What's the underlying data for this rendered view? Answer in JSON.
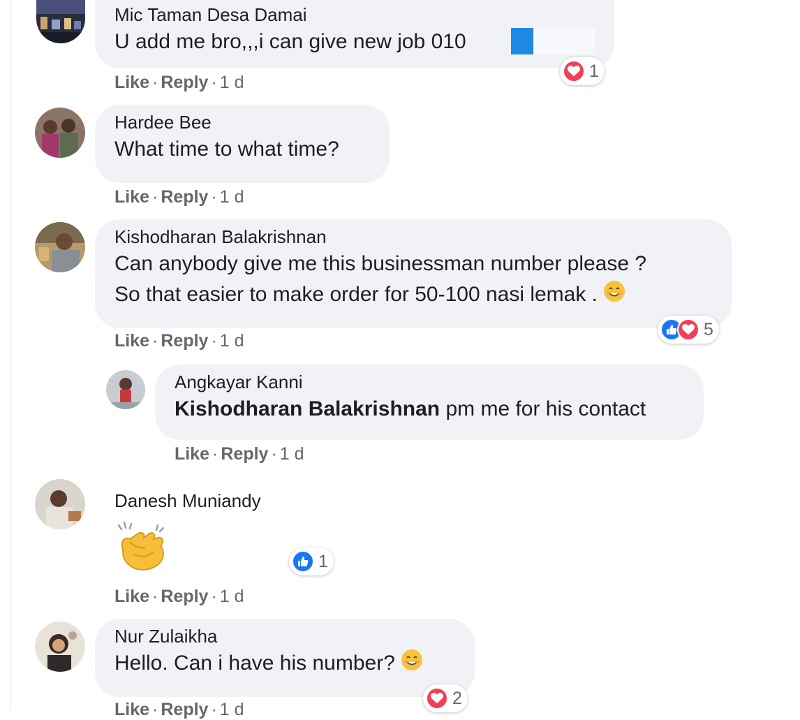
{
  "comments": [
    {
      "author": "Mic Taman Desa Damai",
      "text": "U add me bro,,,i can give new job 010",
      "actions": {
        "like": "Like",
        "reply": "Reply",
        "time": "1 d"
      },
      "reaction_count": "1",
      "reaction_types": [
        "love-icon"
      ]
    },
    {
      "author": "Hardee Bee",
      "text": "What time to what time?",
      "actions": {
        "like": "Like",
        "reply": "Reply",
        "time": "1 d"
      }
    },
    {
      "author": "Kishodharan Balakrishnan",
      "text_line1": "Can anybody give me this businessman number please ?",
      "text_line2": "So that easier to make order for 50-100 nasi lemak .",
      "actions": {
        "like": "Like",
        "reply": "Reply",
        "time": "1 d"
      },
      "reaction_count": "5",
      "reaction_types": [
        "like-icon",
        "love-icon"
      ]
    },
    {
      "author": "Angkayar Kanni",
      "mention": "Kishodharan Balakrishnan",
      "text": " pm me for his contact",
      "actions": {
        "like": "Like",
        "reply": "Reply",
        "time": "1 d"
      }
    },
    {
      "author": "Danesh Muniandy",
      "sticker": "clapping-hands-emoji",
      "actions": {
        "like": "Like",
        "reply": "Reply",
        "time": "1 d"
      },
      "reaction_count": "1",
      "reaction_types": [
        "like-icon"
      ]
    },
    {
      "author": "Nur Zulaikha",
      "text": "Hello. Can i have his number?",
      "actions": {
        "like": "Like",
        "reply": "Reply",
        "time": "1 d"
      },
      "reaction_count": "2",
      "reaction_types": [
        "love-icon"
      ]
    }
  ],
  "colors": {
    "bubble": "#f0f2f5",
    "meta_text": "#65676b",
    "like_blue": "#1877f2",
    "love_red": "#f33e58"
  }
}
